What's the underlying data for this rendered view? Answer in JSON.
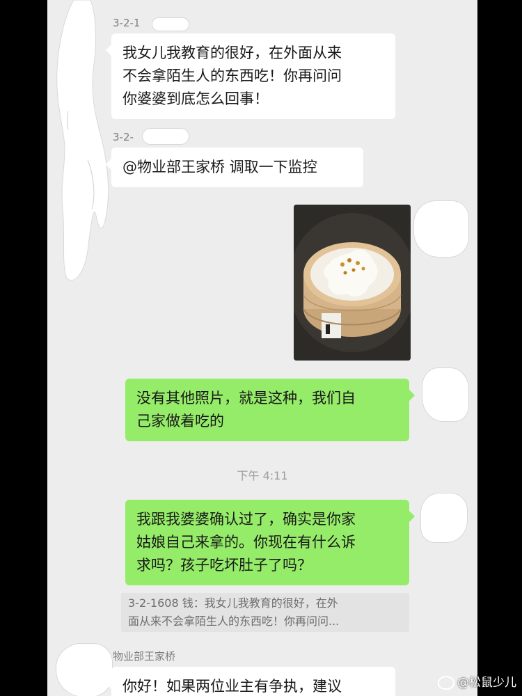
{
  "chat": {
    "messages": [
      {
        "sender": "3-2-1",
        "text": "我女儿我教育的很好，在外面从来不会拿陌生人的东西吃！你再问问你婆婆到底怎么回事！",
        "lines": [
          "我女儿我教育的很好，在外面从来",
          "不会拿陌生人的东西吃！你再问问",
          "你婆婆到底怎么回事！"
        ]
      },
      {
        "sender": "3-2-",
        "text": "@物业部王家桥 调取一下监控"
      },
      {
        "type": "image",
        "icon": "steamed-cake-photo"
      },
      {
        "text": "没有其他照片，就是这种，我们自己家做着吃的",
        "lines": [
          "没有其他照片，就是这种，我们自",
          "己家做着吃的"
        ]
      },
      {
        "timestamp": "下午 4:11"
      },
      {
        "text": "我跟我婆婆确认过了，确实是你家姑娘自己来拿的。你现在有什么诉求吗？孩子吃坏肚子了吗？",
        "lines": [
          "我跟我婆婆确认过了，确实是你家",
          "姑娘自己来拿的。你现在有什么诉",
          "求吗？孩子吃坏肚子了吗？"
        ],
        "quote_lines": [
          "3-2-1608 钱：我女儿我教育的很好，在外",
          "面从来不会拿陌生人的东西吃！你再问问..."
        ]
      },
      {
        "sender": "物业部王家桥",
        "text": "你好！如果两位业主有争执，建议"
      }
    ]
  },
  "watermark": {
    "text": "@松鼠少儿",
    "icon": "weibo-logo-icon"
  },
  "colors": {
    "chat_background": "#ededed",
    "bubble_self": "#95ec69",
    "bubble_other": "#ffffff",
    "text": "#191919",
    "meta_text": "#7d7d7d"
  }
}
